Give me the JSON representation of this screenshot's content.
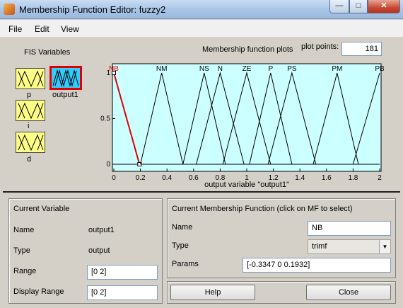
{
  "window": {
    "title": "Membership Function Editor: fuzzy2"
  },
  "titlebar_buttons": {
    "minimize": "—",
    "maximize": "□",
    "close": "✕"
  },
  "menu": [
    "File",
    "Edit",
    "View"
  ],
  "fis": {
    "label": "FIS Variables",
    "variables": [
      {
        "name": "p",
        "kind": "input",
        "selected": false
      },
      {
        "name": "output1",
        "kind": "output",
        "selected": true
      },
      {
        "name": "i",
        "kind": "input",
        "selected": false
      },
      {
        "name": "d",
        "kind": "input",
        "selected": false
      }
    ]
  },
  "plot": {
    "title": "Membership function plots",
    "plot_points_label": "plot points:",
    "plot_points": "181",
    "xlabel": "output variable \"output1\"",
    "colors": {
      "background": "#ccffff",
      "selected": "#e00000",
      "line": "#000000"
    }
  },
  "chart_data": {
    "type": "line",
    "xlim": [
      0,
      2
    ],
    "ylim": [
      0,
      1
    ],
    "x_ticks": [
      "0",
      "0.2",
      "0.4",
      "0.6",
      "0.8",
      "1",
      "1.2",
      "1.4",
      "1.6",
      "1.8",
      "2"
    ],
    "y_ticks": [
      "0",
      "0.5",
      "1"
    ],
    "series": [
      {
        "name": "NB",
        "params": [
          -0.3347,
          0,
          0.1932
        ],
        "selected": true
      },
      {
        "name": "NM",
        "params": [
          0.2,
          0.36,
          0.52
        ],
        "selected": false
      },
      {
        "name": "NS",
        "params": [
          0.52,
          0.68,
          0.84
        ],
        "selected": false
      },
      {
        "name": "N",
        "params": [
          0.62,
          0.8,
          0.98
        ],
        "selected": false
      },
      {
        "name": "ZE",
        "params": [
          0.82,
          1.0,
          1.18
        ],
        "selected": false
      },
      {
        "name": "P",
        "params": [
          1.02,
          1.18,
          1.34
        ],
        "selected": false
      },
      {
        "name": "PS",
        "params": [
          1.16,
          1.34,
          1.52
        ],
        "selected": false
      },
      {
        "name": "PM",
        "params": [
          1.5,
          1.68,
          1.84
        ],
        "selected": false
      },
      {
        "name": "PB",
        "params": [
          1.8,
          2.0,
          2.2
        ],
        "selected": false
      }
    ]
  },
  "current_variable": {
    "title": "Current Variable",
    "name_label": "Name",
    "name_value": "output1",
    "type_label": "Type",
    "type_value": "output",
    "range_label": "Range",
    "range_value": "[0 2]",
    "display_range_label": "Display Range",
    "display_range_value": "[0 2]"
  },
  "current_mf": {
    "title": "Current Membership Function (click on MF to select)",
    "name_label": "Name",
    "name_value": "NB",
    "type_label": "Type",
    "type_value": "trimf",
    "params_label": "Params",
    "params_value": "[-0.3347 0 0.1932]"
  },
  "buttons": {
    "help": "Help",
    "close": "Close"
  }
}
